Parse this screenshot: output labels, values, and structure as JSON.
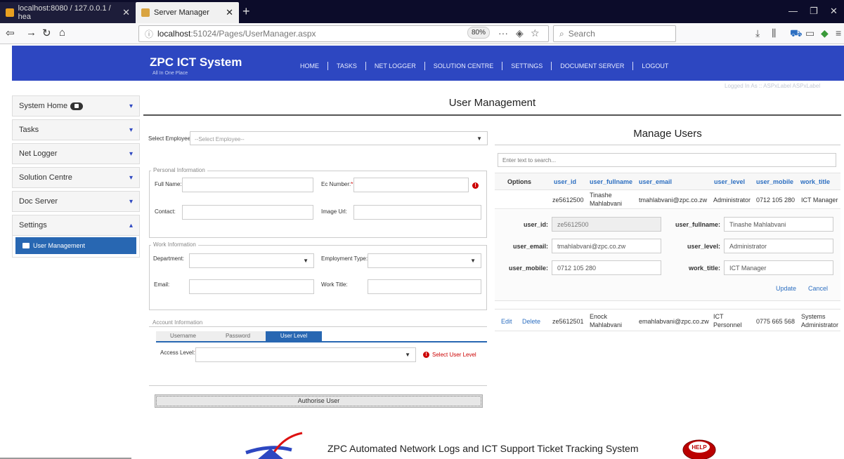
{
  "browser": {
    "tabs": [
      {
        "label": "localhost:8080 / 127.0.0.1 / hea"
      },
      {
        "label": "Server Manager"
      }
    ],
    "url_host": "localhost",
    "url_path": ":51024/Pages/UserManager.aspx",
    "zoom": "80%",
    "search_placeholder": "Search"
  },
  "site": {
    "title": "ZPC ICT System",
    "subtitle": "All In One Place",
    "nav": [
      "HOME",
      "TASKS",
      "NET LOGGER",
      "SOLUTION CENTRE",
      "SETTINGS",
      "DOCUMENT SERVER",
      "LOGOUT"
    ],
    "logged_in": "Logged In As :: ASPxLabel ASPxLabel"
  },
  "sidebar": {
    "items": [
      {
        "label": "System Home"
      },
      {
        "label": "Tasks"
      },
      {
        "label": "Net Logger"
      },
      {
        "label": "Solution Centre"
      },
      {
        "label": "Doc Server"
      },
      {
        "label": "Settings"
      }
    ],
    "sub_item": "User Management"
  },
  "main": {
    "title": "User Management",
    "select_employee_label": "Select Employee:",
    "select_employee_value": "--Select Employee--",
    "personal_legend": "Personal Information",
    "full_name_label": "Full Name:",
    "ec_number_label": "Ec Number:",
    "required_mark": "*",
    "contact_label": "Contact:",
    "image_url_label": "Image Url:",
    "work_legend": "Work Information",
    "department_label": "Department:",
    "employment_type_label": "Employment Type:",
    "email_label": "Email:",
    "work_title_label": "Work Title:",
    "account_legend": "Account Information",
    "account_tabs": [
      "Username",
      "Password",
      "User Level"
    ],
    "access_level_label": "Access Level:",
    "access_level_error": "Select User Level",
    "authorise_button": "Authorise User"
  },
  "manage": {
    "title": "Manage Users",
    "search_placeholder": "Enter text to search...",
    "columns": [
      "Options",
      "user_id",
      "user_fullname",
      "user_email",
      "user_level",
      "user_mobile",
      "work_title"
    ],
    "row1": {
      "user_id": "ze5612500",
      "fullname_1": "Tinashe",
      "fullname_2": "Mahlabvani",
      "email": "tmahlabvani@zpc.co.zw",
      "level": "Administrator",
      "mobile": "0712 105 280",
      "title": "ICT Manager"
    },
    "edit_form": {
      "user_id_label": "user_id:",
      "user_id": "ze5612500",
      "user_fullname_label": "user_fullname:",
      "user_fullname": "Tinashe Mahlabvani",
      "user_email_label": "user_email:",
      "user_email": "tmahlabvani@zpc.co.zw",
      "user_level_label": "user_level:",
      "user_level": "Administrator",
      "user_mobile_label": "user_mobile:",
      "user_mobile": "0712 105 280",
      "work_title_label": "work_title:",
      "work_title": "ICT Manager",
      "update": "Update",
      "cancel": "Cancel"
    },
    "row2": {
      "edit": "Edit",
      "delete": "Delete",
      "user_id": "ze5612501",
      "fullname_1": "Enock",
      "fullname_2": "Mahlabvani",
      "email": "emahlabvani@zpc.co.zw",
      "level_1": "ICT",
      "level_2": "Personnel",
      "mobile": "0775 665 568",
      "title_1": "Systems",
      "title_2": "Administrator"
    }
  },
  "footer": {
    "text": "ZPC Automated Network Logs and ICT Support Ticket Tracking System",
    "help_label": "HELP"
  },
  "colors": {
    "brand": "#2d47c1",
    "link": "#2d6fc1",
    "error": "#cc0000",
    "selected": "#2867b2"
  }
}
